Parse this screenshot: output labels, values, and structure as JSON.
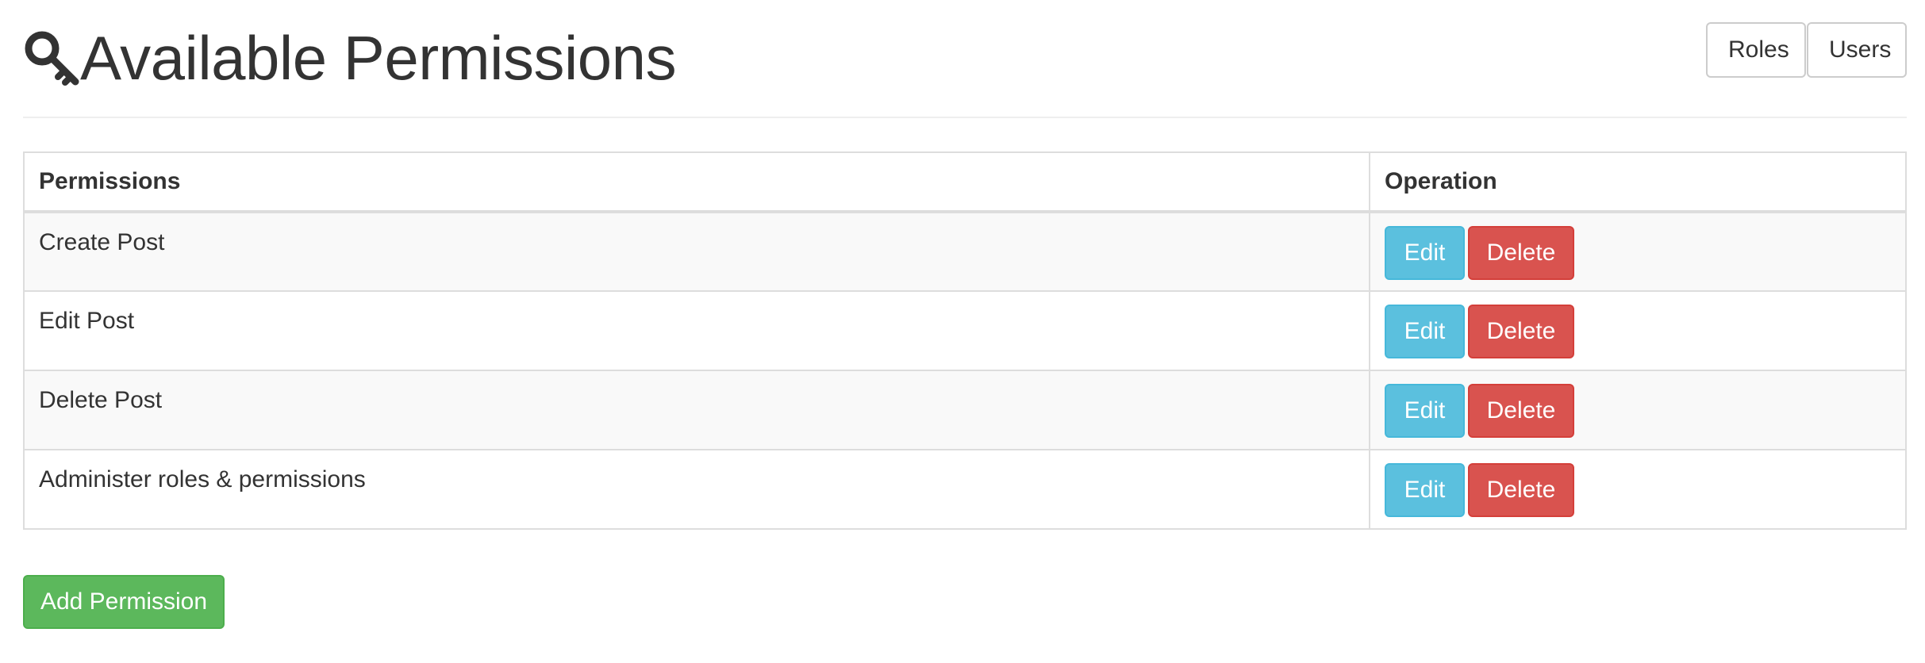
{
  "header": {
    "title": "Available Permissions",
    "icon": "key-icon",
    "nav": {
      "roles_label": "Roles",
      "users_label": "Users"
    }
  },
  "table": {
    "columns": [
      "Permissions",
      "Operation"
    ],
    "rows": [
      {
        "name": "Create Post",
        "edit_label": "Edit",
        "delete_label": "Delete"
      },
      {
        "name": "Edit Post",
        "edit_label": "Edit",
        "delete_label": "Delete"
      },
      {
        "name": "Delete Post",
        "edit_label": "Edit",
        "delete_label": "Delete"
      },
      {
        "name": "Administer roles & permissions",
        "edit_label": "Edit",
        "delete_label": "Delete"
      }
    ]
  },
  "actions": {
    "add_label": "Add Permission"
  },
  "colors": {
    "info": "#5bc0de",
    "danger": "#d9534f",
    "success": "#5cb85c",
    "text": "#333333"
  }
}
